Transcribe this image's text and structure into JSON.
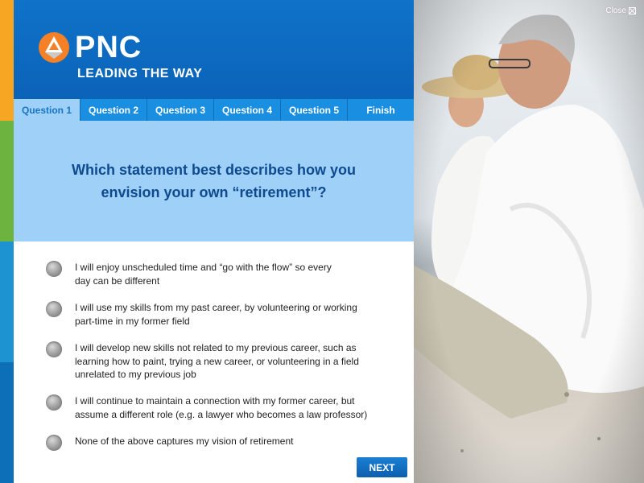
{
  "brand": {
    "name": "PNC",
    "tagline": "LEADING THE WAY",
    "colors": {
      "primary": "#0b63b8",
      "accent": "#f6a623",
      "question_bg": "#9fd0f7",
      "question_text": "#0d4a8f"
    }
  },
  "close": {
    "label": "Close"
  },
  "tabs": [
    {
      "label": "Question 1",
      "active": true
    },
    {
      "label": "Question 2",
      "active": false
    },
    {
      "label": "Question 3",
      "active": false
    },
    {
      "label": "Question 4",
      "active": false
    },
    {
      "label": "Question 5",
      "active": false
    },
    {
      "label": "Finish",
      "active": false
    }
  ],
  "question": "Which statement best describes how you envision your own “retirement”?",
  "options": [
    {
      "text": "I will enjoy unscheduled time and “go with the flow” so every day can be different"
    },
    {
      "text": "I will use my skills from my past career, by volunteering or working part-time in my former field"
    },
    {
      "text": "I will develop new skills not related to my previous career, such as learning how to paint, trying a new career, or volunteering in a field unrelated to my previous job"
    },
    {
      "text": "I will continue to maintain a connection with my former career, but assume a different role (e.g. a lawyer who becomes a law professor)"
    },
    {
      "text": "None of the above captures my vision of retirement"
    }
  ],
  "next_label": "NEXT",
  "photo": {
    "icon": "photo-couple-beach"
  }
}
